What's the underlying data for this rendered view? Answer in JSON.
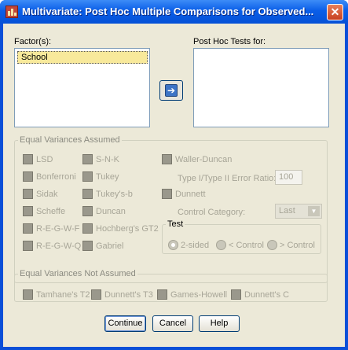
{
  "window": {
    "title": "Multivariate: Post Hoc Multiple Comparisons for Observed...",
    "close_glyph": "✕"
  },
  "factors": {
    "label": "Factor(s):",
    "items": [
      "School"
    ]
  },
  "move_button": {
    "glyph": "➔"
  },
  "post_hoc": {
    "label": "Post Hoc Tests for:",
    "items": []
  },
  "equal_variances": {
    "title": "Equal Variances Assumed",
    "col1": [
      "LSD",
      "Bonferroni",
      "Sidak",
      "Scheffe",
      "R-E-G-W-F",
      "R-E-G-W-Q"
    ],
    "col2": [
      "S-N-K",
      "Tukey",
      "Tukey's-b",
      "Duncan",
      "Hochberg's GT2",
      "Gabriel"
    ],
    "waller": "Waller-Duncan",
    "error_ratio_label": "Type I/Type II Error Ratio:",
    "error_ratio_value": "100",
    "dunnett": "Dunnett",
    "control_category_label": "Control Category:",
    "control_category_value": "Last",
    "test": {
      "title": "Test",
      "options": [
        "2-sided",
        "< Control",
        "> Control"
      ],
      "selected": "2-sided"
    }
  },
  "not_equal_variances": {
    "title": "Equal Variances Not Assumed",
    "items": [
      "Tamhane's T2",
      "Dunnett's T3",
      "Games-Howell",
      "Dunnett's C"
    ]
  },
  "buttons": {
    "continue": "Continue",
    "cancel": "Cancel",
    "help": "Help"
  }
}
